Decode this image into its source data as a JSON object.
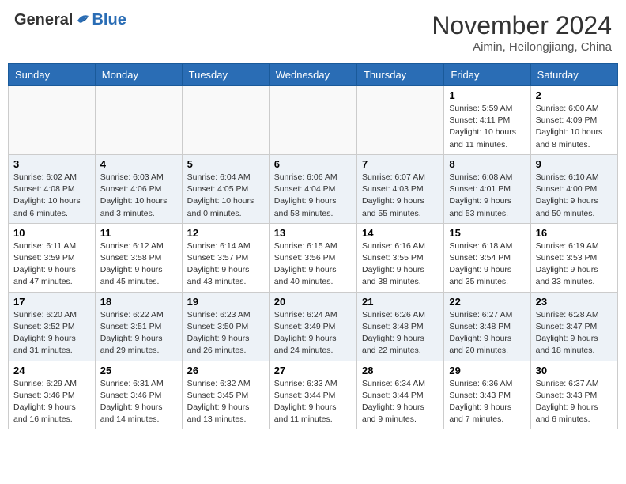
{
  "header": {
    "logo_general": "General",
    "logo_blue": "Blue",
    "month": "November 2024",
    "location": "Aimin, Heilongjiang, China"
  },
  "weekdays": [
    "Sunday",
    "Monday",
    "Tuesday",
    "Wednesday",
    "Thursday",
    "Friday",
    "Saturday"
  ],
  "weeks": [
    [
      {
        "day": "",
        "info": ""
      },
      {
        "day": "",
        "info": ""
      },
      {
        "day": "",
        "info": ""
      },
      {
        "day": "",
        "info": ""
      },
      {
        "day": "",
        "info": ""
      },
      {
        "day": "1",
        "info": "Sunrise: 5:59 AM\nSunset: 4:11 PM\nDaylight: 10 hours\nand 11 minutes."
      },
      {
        "day": "2",
        "info": "Sunrise: 6:00 AM\nSunset: 4:09 PM\nDaylight: 10 hours\nand 8 minutes."
      }
    ],
    [
      {
        "day": "3",
        "info": "Sunrise: 6:02 AM\nSunset: 4:08 PM\nDaylight: 10 hours\nand 6 minutes."
      },
      {
        "day": "4",
        "info": "Sunrise: 6:03 AM\nSunset: 4:06 PM\nDaylight: 10 hours\nand 3 minutes."
      },
      {
        "day": "5",
        "info": "Sunrise: 6:04 AM\nSunset: 4:05 PM\nDaylight: 10 hours\nand 0 minutes."
      },
      {
        "day": "6",
        "info": "Sunrise: 6:06 AM\nSunset: 4:04 PM\nDaylight: 9 hours\nand 58 minutes."
      },
      {
        "day": "7",
        "info": "Sunrise: 6:07 AM\nSunset: 4:03 PM\nDaylight: 9 hours\nand 55 minutes."
      },
      {
        "day": "8",
        "info": "Sunrise: 6:08 AM\nSunset: 4:01 PM\nDaylight: 9 hours\nand 53 minutes."
      },
      {
        "day": "9",
        "info": "Sunrise: 6:10 AM\nSunset: 4:00 PM\nDaylight: 9 hours\nand 50 minutes."
      }
    ],
    [
      {
        "day": "10",
        "info": "Sunrise: 6:11 AM\nSunset: 3:59 PM\nDaylight: 9 hours\nand 47 minutes."
      },
      {
        "day": "11",
        "info": "Sunrise: 6:12 AM\nSunset: 3:58 PM\nDaylight: 9 hours\nand 45 minutes."
      },
      {
        "day": "12",
        "info": "Sunrise: 6:14 AM\nSunset: 3:57 PM\nDaylight: 9 hours\nand 43 minutes."
      },
      {
        "day": "13",
        "info": "Sunrise: 6:15 AM\nSunset: 3:56 PM\nDaylight: 9 hours\nand 40 minutes."
      },
      {
        "day": "14",
        "info": "Sunrise: 6:16 AM\nSunset: 3:55 PM\nDaylight: 9 hours\nand 38 minutes."
      },
      {
        "day": "15",
        "info": "Sunrise: 6:18 AM\nSunset: 3:54 PM\nDaylight: 9 hours\nand 35 minutes."
      },
      {
        "day": "16",
        "info": "Sunrise: 6:19 AM\nSunset: 3:53 PM\nDaylight: 9 hours\nand 33 minutes."
      }
    ],
    [
      {
        "day": "17",
        "info": "Sunrise: 6:20 AM\nSunset: 3:52 PM\nDaylight: 9 hours\nand 31 minutes."
      },
      {
        "day": "18",
        "info": "Sunrise: 6:22 AM\nSunset: 3:51 PM\nDaylight: 9 hours\nand 29 minutes."
      },
      {
        "day": "19",
        "info": "Sunrise: 6:23 AM\nSunset: 3:50 PM\nDaylight: 9 hours\nand 26 minutes."
      },
      {
        "day": "20",
        "info": "Sunrise: 6:24 AM\nSunset: 3:49 PM\nDaylight: 9 hours\nand 24 minutes."
      },
      {
        "day": "21",
        "info": "Sunrise: 6:26 AM\nSunset: 3:48 PM\nDaylight: 9 hours\nand 22 minutes."
      },
      {
        "day": "22",
        "info": "Sunrise: 6:27 AM\nSunset: 3:48 PM\nDaylight: 9 hours\nand 20 minutes."
      },
      {
        "day": "23",
        "info": "Sunrise: 6:28 AM\nSunset: 3:47 PM\nDaylight: 9 hours\nand 18 minutes."
      }
    ],
    [
      {
        "day": "24",
        "info": "Sunrise: 6:29 AM\nSunset: 3:46 PM\nDaylight: 9 hours\nand 16 minutes."
      },
      {
        "day": "25",
        "info": "Sunrise: 6:31 AM\nSunset: 3:46 PM\nDaylight: 9 hours\nand 14 minutes."
      },
      {
        "day": "26",
        "info": "Sunrise: 6:32 AM\nSunset: 3:45 PM\nDaylight: 9 hours\nand 13 minutes."
      },
      {
        "day": "27",
        "info": "Sunrise: 6:33 AM\nSunset: 3:44 PM\nDaylight: 9 hours\nand 11 minutes."
      },
      {
        "day": "28",
        "info": "Sunrise: 6:34 AM\nSunset: 3:44 PM\nDaylight: 9 hours\nand 9 minutes."
      },
      {
        "day": "29",
        "info": "Sunrise: 6:36 AM\nSunset: 3:43 PM\nDaylight: 9 hours\nand 7 minutes."
      },
      {
        "day": "30",
        "info": "Sunrise: 6:37 AM\nSunset: 3:43 PM\nDaylight: 9 hours\nand 6 minutes."
      }
    ]
  ]
}
